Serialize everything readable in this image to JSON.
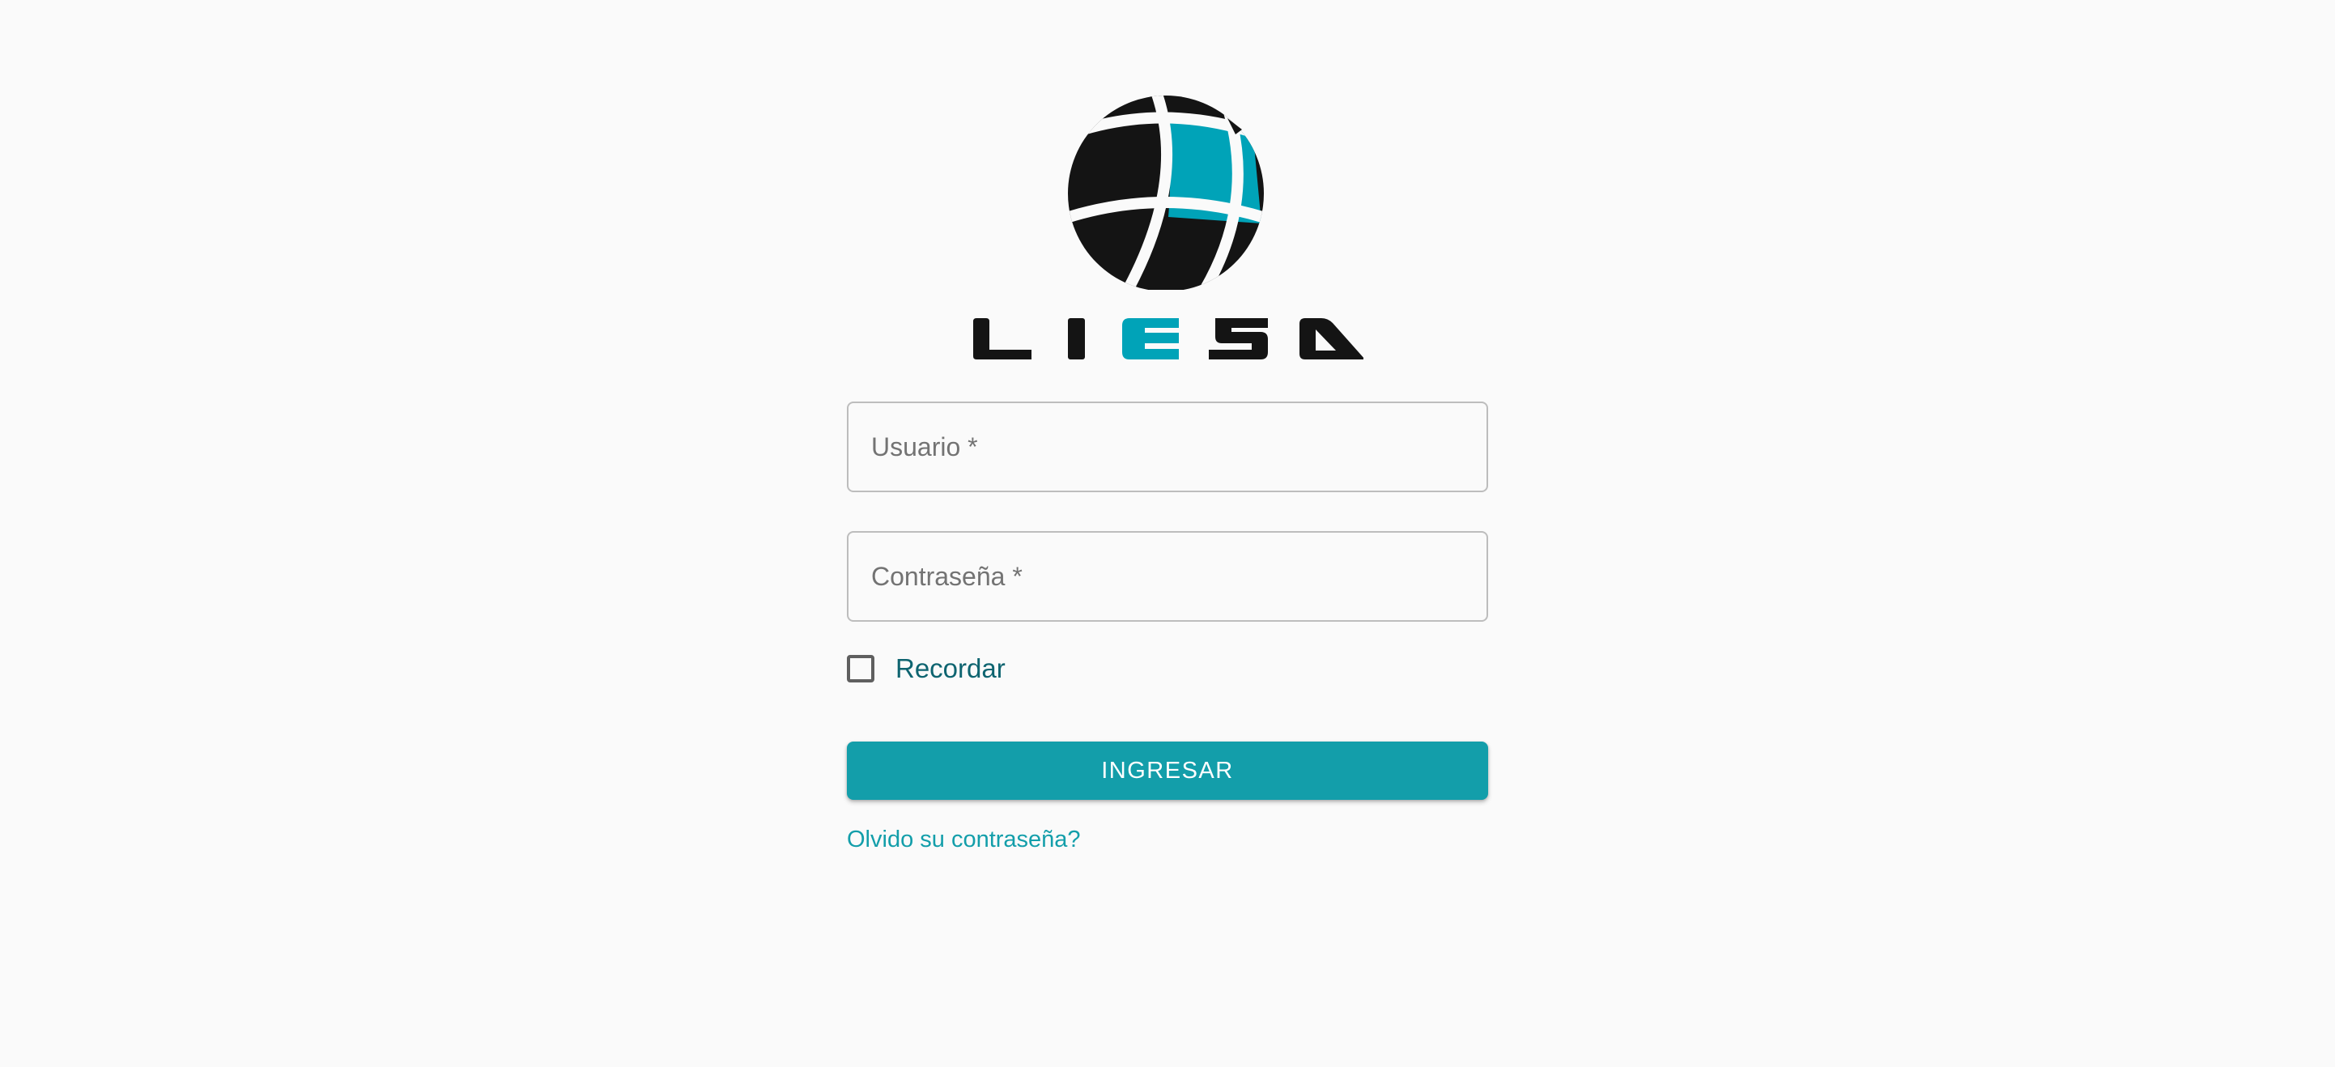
{
  "branding": {
    "logo_text": "LIESA",
    "accent_color": "#00a3b8",
    "dark_color": "#141414"
  },
  "form": {
    "username_placeholder": "Usuario *",
    "username_value": "",
    "password_placeholder": "Contraseña *",
    "password_value": "",
    "remember_label": "Recordar",
    "remember_checked": false,
    "submit_label": "INGRESAR",
    "forgot_label": "Olvido su contraseña?",
    "button_color": "#139eaa",
    "link_color": "#139eaa"
  }
}
